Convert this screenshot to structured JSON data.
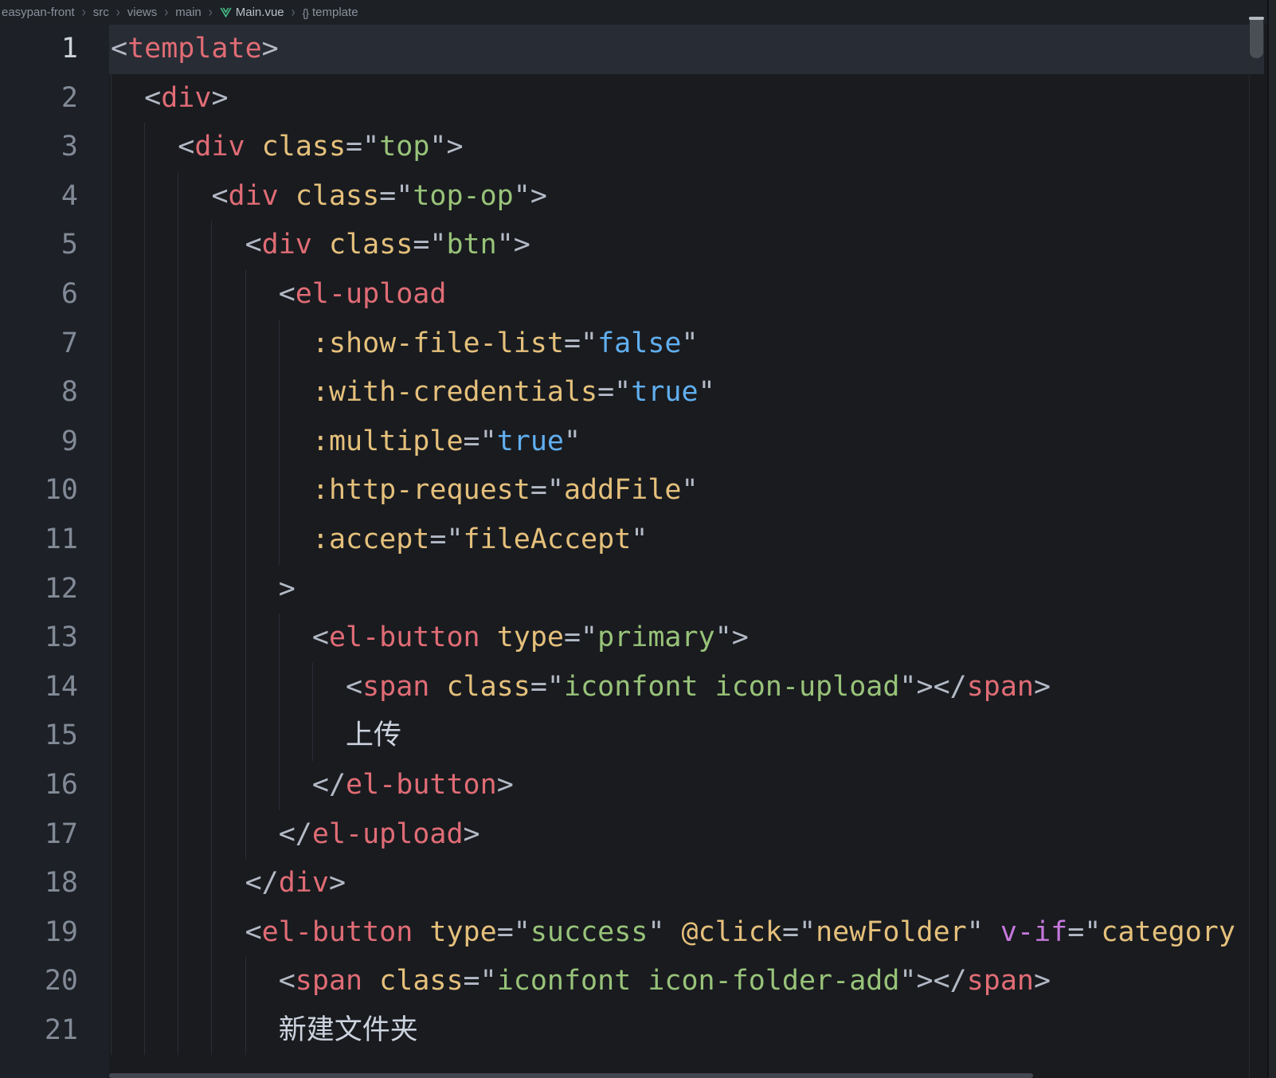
{
  "breadcrumb": {
    "separator": "›",
    "items": [
      {
        "label": "easypan-front"
      },
      {
        "label": "src"
      },
      {
        "label": "views"
      },
      {
        "label": "main"
      },
      {
        "label": "Main.vue",
        "icon": "vue-logo",
        "emphasis": true
      },
      {
        "label": "template",
        "icon": "braces",
        "glyph": "{}"
      }
    ]
  },
  "editor": {
    "file_language": "vue-template",
    "active_line": 1,
    "colors": {
      "background": "#191b1f",
      "gutter_background": "#1d2026",
      "breadcrumb_background": "#1d2024",
      "active_line_highlight": "#282c34",
      "tag": "#e06c75",
      "attribute": "#e5c07b",
      "string": "#98c379",
      "constant": "#61afef",
      "directive": "#c678dd",
      "punctuation": "#b3bac6",
      "text": "#ccd3de",
      "vue_logo_green": "#42b883"
    },
    "lines": [
      {
        "n": 1,
        "indent": 0,
        "guides": 0,
        "tokens": [
          [
            "p",
            "<"
          ],
          [
            "t",
            "template"
          ],
          [
            "p",
            ">"
          ]
        ]
      },
      {
        "n": 2,
        "indent": 2,
        "guides": 1,
        "tokens": [
          [
            "p",
            "<"
          ],
          [
            "t",
            "div"
          ],
          [
            "p",
            ">"
          ]
        ]
      },
      {
        "n": 3,
        "indent": 4,
        "guides": 2,
        "tokens": [
          [
            "p",
            "<"
          ],
          [
            "t",
            "div"
          ],
          [
            "w",
            " "
          ],
          [
            "a",
            "class"
          ],
          [
            "p",
            "=\""
          ],
          [
            "s",
            "top"
          ],
          [
            "p",
            "\">"
          ]
        ]
      },
      {
        "n": 4,
        "indent": 6,
        "guides": 3,
        "tokens": [
          [
            "p",
            "<"
          ],
          [
            "t",
            "div"
          ],
          [
            "w",
            " "
          ],
          [
            "a",
            "class"
          ],
          [
            "p",
            "=\""
          ],
          [
            "s",
            "top-op"
          ],
          [
            "p",
            "\">"
          ]
        ]
      },
      {
        "n": 5,
        "indent": 8,
        "guides": 4,
        "tokens": [
          [
            "p",
            "<"
          ],
          [
            "t",
            "div"
          ],
          [
            "w",
            " "
          ],
          [
            "a",
            "class"
          ],
          [
            "p",
            "=\""
          ],
          [
            "s",
            "btn"
          ],
          [
            "p",
            "\">"
          ]
        ]
      },
      {
        "n": 6,
        "indent": 10,
        "guides": 5,
        "tokens": [
          [
            "p",
            "<"
          ],
          [
            "t",
            "el-upload"
          ]
        ]
      },
      {
        "n": 7,
        "indent": 12,
        "guides": 6,
        "tokens": [
          [
            "a",
            ":show-file-list"
          ],
          [
            "p",
            "=\""
          ],
          [
            "b",
            "false"
          ],
          [
            "p",
            "\""
          ]
        ]
      },
      {
        "n": 8,
        "indent": 12,
        "guides": 6,
        "tokens": [
          [
            "a",
            ":with-credentials"
          ],
          [
            "p",
            "=\""
          ],
          [
            "b",
            "true"
          ],
          [
            "p",
            "\""
          ]
        ]
      },
      {
        "n": 9,
        "indent": 12,
        "guides": 6,
        "tokens": [
          [
            "a",
            ":multiple"
          ],
          [
            "p",
            "=\""
          ],
          [
            "b",
            "true"
          ],
          [
            "p",
            "\""
          ]
        ]
      },
      {
        "n": 10,
        "indent": 12,
        "guides": 6,
        "tokens": [
          [
            "a",
            ":http-request"
          ],
          [
            "p",
            "=\""
          ],
          [
            "a",
            "addFile"
          ],
          [
            "p",
            "\""
          ]
        ]
      },
      {
        "n": 11,
        "indent": 12,
        "guides": 6,
        "tokens": [
          [
            "a",
            ":accept"
          ],
          [
            "p",
            "=\""
          ],
          [
            "a",
            "fileAccept"
          ],
          [
            "p",
            "\""
          ]
        ]
      },
      {
        "n": 12,
        "indent": 10,
        "guides": 5,
        "tokens": [
          [
            "p",
            ">"
          ]
        ]
      },
      {
        "n": 13,
        "indent": 12,
        "guides": 6,
        "tokens": [
          [
            "p",
            "<"
          ],
          [
            "t",
            "el-button"
          ],
          [
            "w",
            " "
          ],
          [
            "a",
            "type"
          ],
          [
            "p",
            "=\""
          ],
          [
            "s",
            "primary"
          ],
          [
            "p",
            "\">"
          ]
        ]
      },
      {
        "n": 14,
        "indent": 14,
        "guides": 7,
        "tokens": [
          [
            "p",
            "<"
          ],
          [
            "t",
            "span"
          ],
          [
            "w",
            " "
          ],
          [
            "a",
            "class"
          ],
          [
            "p",
            "=\""
          ],
          [
            "s",
            "iconfont icon-upload"
          ],
          [
            "p",
            "\"></"
          ],
          [
            "t",
            "span"
          ],
          [
            "p",
            ">"
          ]
        ]
      },
      {
        "n": 15,
        "indent": 14,
        "guides": 7,
        "tokens": [
          [
            "x",
            "上传"
          ]
        ]
      },
      {
        "n": 16,
        "indent": 12,
        "guides": 6,
        "tokens": [
          [
            "p",
            "</"
          ],
          [
            "t",
            "el-button"
          ],
          [
            "p",
            ">"
          ]
        ]
      },
      {
        "n": 17,
        "indent": 10,
        "guides": 5,
        "tokens": [
          [
            "p",
            "</"
          ],
          [
            "t",
            "el-upload"
          ],
          [
            "p",
            ">"
          ]
        ]
      },
      {
        "n": 18,
        "indent": 8,
        "guides": 4,
        "tokens": [
          [
            "p",
            "</"
          ],
          [
            "t",
            "div"
          ],
          [
            "p",
            ">"
          ]
        ]
      },
      {
        "n": 19,
        "indent": 8,
        "guides": 4,
        "tokens": [
          [
            "p",
            "<"
          ],
          [
            "t",
            "el-button"
          ],
          [
            "w",
            " "
          ],
          [
            "a",
            "type"
          ],
          [
            "p",
            "=\""
          ],
          [
            "s",
            "success"
          ],
          [
            "p",
            "\""
          ],
          [
            "w",
            " "
          ],
          [
            "a",
            "@click"
          ],
          [
            "p",
            "=\""
          ],
          [
            "a",
            "newFolder"
          ],
          [
            "p",
            "\""
          ],
          [
            "w",
            " "
          ],
          [
            "d",
            "v-if"
          ],
          [
            "p",
            "=\""
          ],
          [
            "a",
            "category"
          ]
        ]
      },
      {
        "n": 20,
        "indent": 10,
        "guides": 5,
        "tokens": [
          [
            "p",
            "<"
          ],
          [
            "t",
            "span"
          ],
          [
            "w",
            " "
          ],
          [
            "a",
            "class"
          ],
          [
            "p",
            "=\""
          ],
          [
            "s",
            "iconfont icon-folder-add"
          ],
          [
            "p",
            "\"></"
          ],
          [
            "t",
            "span"
          ],
          [
            "p",
            ">"
          ]
        ]
      },
      {
        "n": 21,
        "indent": 10,
        "guides": 5,
        "tokens": [
          [
            "x",
            "新建文件夹"
          ]
        ]
      }
    ]
  }
}
